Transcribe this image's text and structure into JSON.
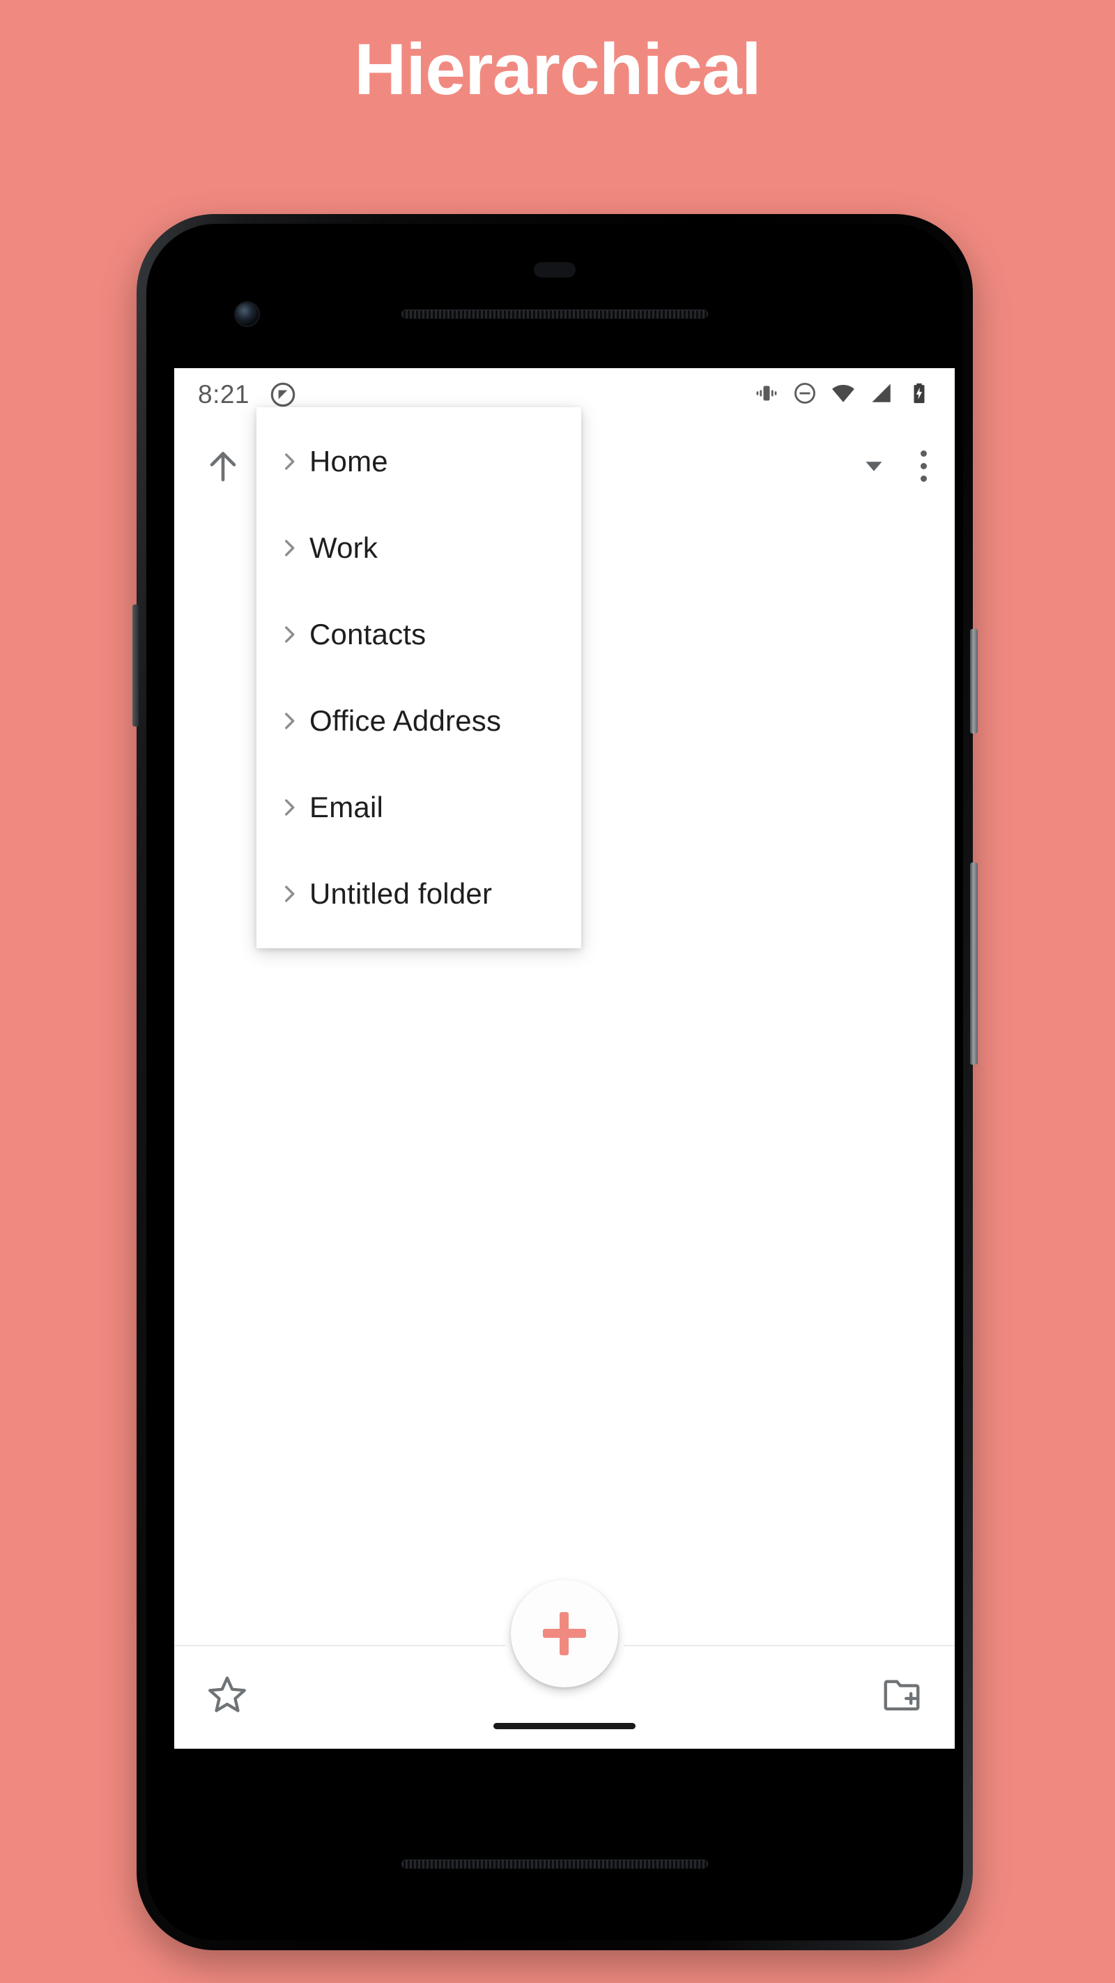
{
  "page": {
    "title": "Hierarchical",
    "background_color": "#F08A80",
    "accent_color": "#F08A80"
  },
  "phone": {
    "frame_color": "#000000",
    "screen_background": "#FFFFFF"
  },
  "status_bar": {
    "time": "8:21",
    "left_icons": [
      {
        "name": "datasaver-icon",
        "glyph": "circle-slash"
      }
    ],
    "right_icons": [
      {
        "name": "vibrate-icon",
        "glyph": "vibrate"
      },
      {
        "name": "do-not-disturb-icon",
        "glyph": "minus-circle"
      },
      {
        "name": "wifi-icon",
        "glyph": "wifi"
      },
      {
        "name": "cellular-signal-icon",
        "glyph": "signal"
      },
      {
        "name": "battery-icon",
        "glyph": "battery-charging"
      }
    ]
  },
  "toolbar": {
    "up_label": "Navigate up",
    "dropdown_label": "Sort dropdown",
    "overflow_label": "More options"
  },
  "dropdown_menu": {
    "visible": true,
    "items": [
      {
        "label": "Home",
        "chevron": ">"
      },
      {
        "label": "Work",
        "chevron": ">"
      },
      {
        "label": "Contacts",
        "chevron": ">"
      },
      {
        "label": "Office Address",
        "chevron": ">"
      },
      {
        "label": "Email",
        "chevron": ">"
      },
      {
        "label": "Untitled folder",
        "chevron": ">"
      }
    ]
  },
  "bottom_bar": {
    "left_action": {
      "name": "favorites",
      "label": "Favorites",
      "glyph": "star-outline"
    },
    "right_action": {
      "name": "new-folder",
      "label": "New folder",
      "glyph": "folder-add"
    },
    "fab": {
      "label": "Add",
      "glyph": "plus",
      "color": "#F08A80"
    }
  }
}
